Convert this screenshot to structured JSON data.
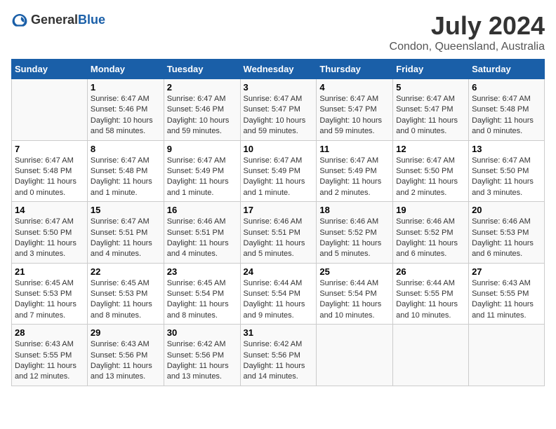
{
  "logo": {
    "general": "General",
    "blue": "Blue"
  },
  "title": "July 2024",
  "subtitle": "Condon, Queensland, Australia",
  "weekdays": [
    "Sunday",
    "Monday",
    "Tuesday",
    "Wednesday",
    "Thursday",
    "Friday",
    "Saturday"
  ],
  "weeks": [
    [
      {
        "day": "",
        "info": ""
      },
      {
        "day": "1",
        "info": "Sunrise: 6:47 AM\nSunset: 5:46 PM\nDaylight: 10 hours\nand 58 minutes."
      },
      {
        "day": "2",
        "info": "Sunrise: 6:47 AM\nSunset: 5:46 PM\nDaylight: 10 hours\nand 59 minutes."
      },
      {
        "day": "3",
        "info": "Sunrise: 6:47 AM\nSunset: 5:47 PM\nDaylight: 10 hours\nand 59 minutes."
      },
      {
        "day": "4",
        "info": "Sunrise: 6:47 AM\nSunset: 5:47 PM\nDaylight: 10 hours\nand 59 minutes."
      },
      {
        "day": "5",
        "info": "Sunrise: 6:47 AM\nSunset: 5:47 PM\nDaylight: 11 hours\nand 0 minutes."
      },
      {
        "day": "6",
        "info": "Sunrise: 6:47 AM\nSunset: 5:48 PM\nDaylight: 11 hours\nand 0 minutes."
      }
    ],
    [
      {
        "day": "7",
        "info": "Sunrise: 6:47 AM\nSunset: 5:48 PM\nDaylight: 11 hours\nand 0 minutes."
      },
      {
        "day": "8",
        "info": "Sunrise: 6:47 AM\nSunset: 5:48 PM\nDaylight: 11 hours\nand 1 minute."
      },
      {
        "day": "9",
        "info": "Sunrise: 6:47 AM\nSunset: 5:49 PM\nDaylight: 11 hours\nand 1 minute."
      },
      {
        "day": "10",
        "info": "Sunrise: 6:47 AM\nSunset: 5:49 PM\nDaylight: 11 hours\nand 1 minute."
      },
      {
        "day": "11",
        "info": "Sunrise: 6:47 AM\nSunset: 5:49 PM\nDaylight: 11 hours\nand 2 minutes."
      },
      {
        "day": "12",
        "info": "Sunrise: 6:47 AM\nSunset: 5:50 PM\nDaylight: 11 hours\nand 2 minutes."
      },
      {
        "day": "13",
        "info": "Sunrise: 6:47 AM\nSunset: 5:50 PM\nDaylight: 11 hours\nand 3 minutes."
      }
    ],
    [
      {
        "day": "14",
        "info": "Sunrise: 6:47 AM\nSunset: 5:50 PM\nDaylight: 11 hours\nand 3 minutes."
      },
      {
        "day": "15",
        "info": "Sunrise: 6:47 AM\nSunset: 5:51 PM\nDaylight: 11 hours\nand 4 minutes."
      },
      {
        "day": "16",
        "info": "Sunrise: 6:46 AM\nSunset: 5:51 PM\nDaylight: 11 hours\nand 4 minutes."
      },
      {
        "day": "17",
        "info": "Sunrise: 6:46 AM\nSunset: 5:51 PM\nDaylight: 11 hours\nand 5 minutes."
      },
      {
        "day": "18",
        "info": "Sunrise: 6:46 AM\nSunset: 5:52 PM\nDaylight: 11 hours\nand 5 minutes."
      },
      {
        "day": "19",
        "info": "Sunrise: 6:46 AM\nSunset: 5:52 PM\nDaylight: 11 hours\nand 6 minutes."
      },
      {
        "day": "20",
        "info": "Sunrise: 6:46 AM\nSunset: 5:53 PM\nDaylight: 11 hours\nand 6 minutes."
      }
    ],
    [
      {
        "day": "21",
        "info": "Sunrise: 6:45 AM\nSunset: 5:53 PM\nDaylight: 11 hours\nand 7 minutes."
      },
      {
        "day": "22",
        "info": "Sunrise: 6:45 AM\nSunset: 5:53 PM\nDaylight: 11 hours\nand 8 minutes."
      },
      {
        "day": "23",
        "info": "Sunrise: 6:45 AM\nSunset: 5:54 PM\nDaylight: 11 hours\nand 8 minutes."
      },
      {
        "day": "24",
        "info": "Sunrise: 6:44 AM\nSunset: 5:54 PM\nDaylight: 11 hours\nand 9 minutes."
      },
      {
        "day": "25",
        "info": "Sunrise: 6:44 AM\nSunset: 5:54 PM\nDaylight: 11 hours\nand 10 minutes."
      },
      {
        "day": "26",
        "info": "Sunrise: 6:44 AM\nSunset: 5:55 PM\nDaylight: 11 hours\nand 10 minutes."
      },
      {
        "day": "27",
        "info": "Sunrise: 6:43 AM\nSunset: 5:55 PM\nDaylight: 11 hours\nand 11 minutes."
      }
    ],
    [
      {
        "day": "28",
        "info": "Sunrise: 6:43 AM\nSunset: 5:55 PM\nDaylight: 11 hours\nand 12 minutes."
      },
      {
        "day": "29",
        "info": "Sunrise: 6:43 AM\nSunset: 5:56 PM\nDaylight: 11 hours\nand 13 minutes."
      },
      {
        "day": "30",
        "info": "Sunrise: 6:42 AM\nSunset: 5:56 PM\nDaylight: 11 hours\nand 13 minutes."
      },
      {
        "day": "31",
        "info": "Sunrise: 6:42 AM\nSunset: 5:56 PM\nDaylight: 11 hours\nand 14 minutes."
      },
      {
        "day": "",
        "info": ""
      },
      {
        "day": "",
        "info": ""
      },
      {
        "day": "",
        "info": ""
      }
    ]
  ]
}
